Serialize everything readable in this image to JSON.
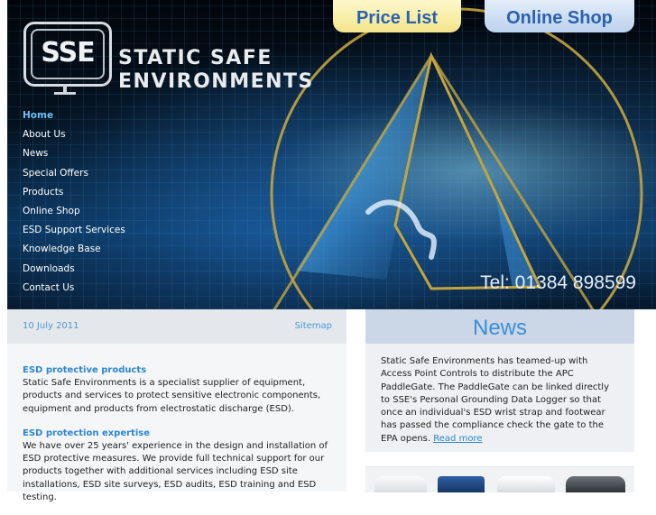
{
  "header": {
    "logo_mark": "SSE",
    "logo_line1": "STATIC SAFE",
    "logo_line2": "ENVIRONMENTS",
    "price_list": "Price List",
    "online_shop": "Online Shop",
    "phone": "Tel: 01384 898599"
  },
  "nav": {
    "items": [
      "Home",
      "About Us",
      "News",
      "Special Offers",
      "Products",
      "Online Shop",
      "ESD Support Services",
      "Knowledge Base",
      "Downloads",
      "Contact Us"
    ],
    "active_index": 0
  },
  "infobar": {
    "date": "10 July 2011",
    "sitemap": "Sitemap"
  },
  "main": {
    "sections": [
      {
        "heading": "ESD protective products",
        "body": "Static Safe Environments is a specialist supplier of equipment, products and services to protect sensitive electronic components, equipment and products from electrostatic discharge (ESD)."
      },
      {
        "heading": "ESD protection expertise",
        "body": "We have over 25 years' experience in the design and installation of ESD protective measures. We provide full technical support for our products together with additional services including ESD site installations, ESD site surveys, ESD audits, ESD training and ESD testing."
      }
    ]
  },
  "news": {
    "title": "News",
    "body": "Static Safe Environments has teamed-up with Access Point Controls to distribute the APC PaddleGate. The PaddleGate can be linked directly to SSE's Personal Grounding Data Logger so that once an individual's ESD wrist strap and footwear has passed the compliance check the gate to the EPA opens.",
    "read_more": "Read more"
  },
  "colors": {
    "link": "#2b86d4",
    "nav_active": "#6cc3f5",
    "news_header": "#cbd7e6",
    "price_tab": "#f3e58a",
    "shop_tab": "#bcd2ee"
  }
}
